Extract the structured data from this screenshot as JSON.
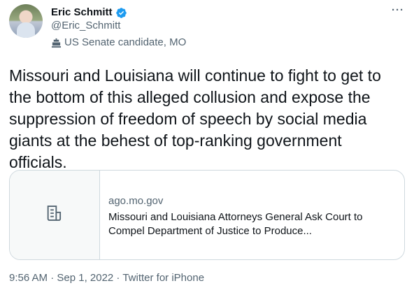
{
  "author": {
    "display_name": "Eric Schmitt",
    "handle": "@Eric_Schmitt",
    "label": "US Senate candidate, MO",
    "verified_icon": "verified-badge-icon",
    "label_icon": "government-building-icon"
  },
  "more_label": "···",
  "tweet": {
    "text": "Missouri and Louisiana will continue to fight to get to\nthe bottom of this alleged collusion and expose the\nsuppression of freedom of speech by social media\ngiants at the behest of top-ranking government\nofficials."
  },
  "card": {
    "domain": "ago.mo.gov",
    "title": "Missouri and Louisiana Attorneys General Ask Court to Compel Department of Justice to Produce...",
    "thumb_icon": "article-icon"
  },
  "meta": {
    "time_date_source": "9:56 AM · Sep 1, 2022 · Twitter for iPhone"
  },
  "colors": {
    "accent": "#1d9bf0",
    "secondary_text": "#536471",
    "border": "#cfd9de"
  }
}
